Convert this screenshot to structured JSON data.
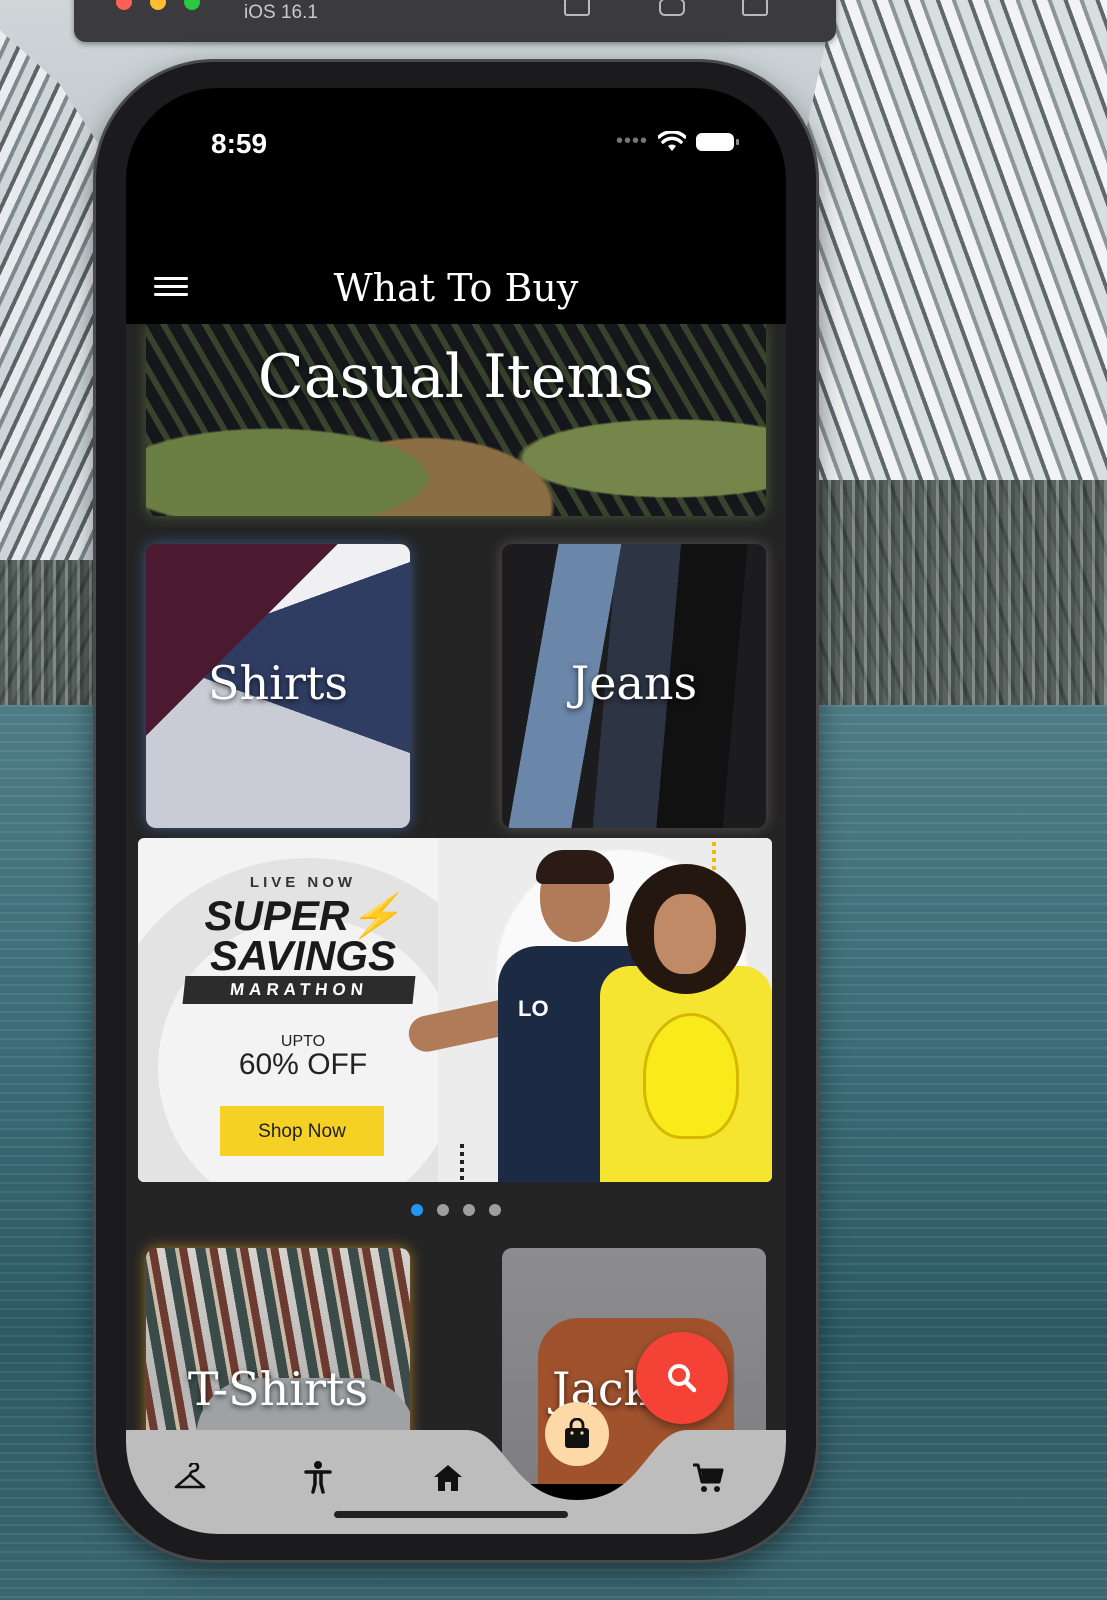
{
  "simulator": {
    "os_version": "iOS 16.1"
  },
  "status_bar": {
    "time": "8:59"
  },
  "app_bar": {
    "title": "What To Buy",
    "menu_icon": "menu-icon"
  },
  "categories": {
    "casual": "Casual Items",
    "shirts": "Shirts",
    "jeans": "Jeans",
    "tshirts": "T-Shirts",
    "jackets": "Jack"
  },
  "banner": {
    "live_now": "LIVE NOW",
    "line1": "SUPER",
    "line2": "SAVINGS",
    "marathon": "MARATHON",
    "upto": "UPTO",
    "offer": "60% OFF",
    "cta": "Shop Now",
    "shirt_text": "LO"
  },
  "pager": {
    "total": 4,
    "active_index": 0
  },
  "fab": {
    "icon": "search-icon"
  },
  "bottom_nav": {
    "items": [
      "hanger-icon",
      "accessibility-icon",
      "home-icon",
      "shopping-bag-icon",
      "cart-icon"
    ],
    "active": "shopping-bag-icon"
  },
  "colors": {
    "pager_active": "#2196f3",
    "fab": "#f44336",
    "nav_active_bg": "#fdd9a8",
    "shop_now": "#f5d025"
  }
}
